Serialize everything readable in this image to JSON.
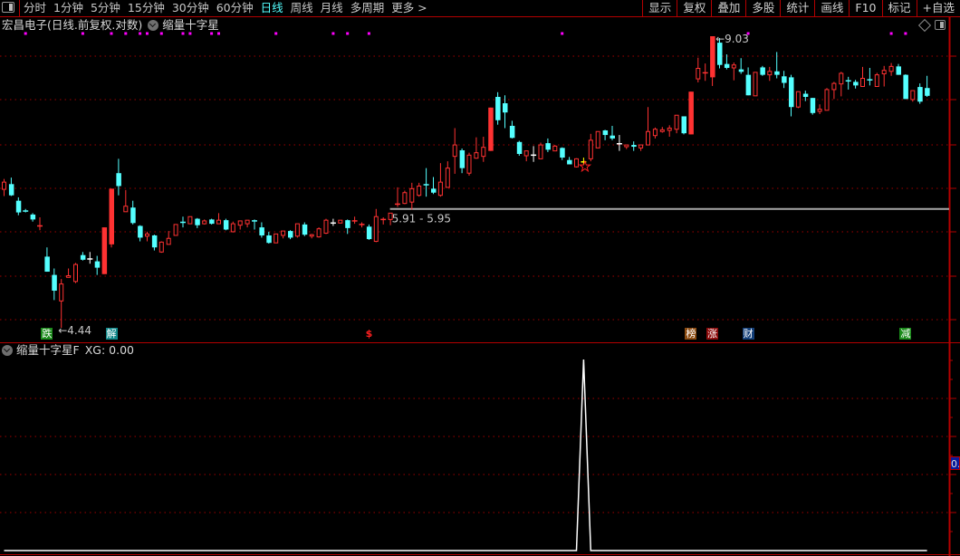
{
  "toolbar": {
    "tabs": [
      "分时",
      "1分钟",
      "5分钟",
      "15分钟",
      "30分钟",
      "60分钟",
      "日线",
      "周线",
      "月线",
      "多周期",
      "更多 >"
    ],
    "active_tab": "日线",
    "right_buttons": [
      "显示",
      "复权",
      "叠加",
      "多股",
      "统计",
      "画线",
      "F10",
      "标记",
      "+自选"
    ]
  },
  "main_panel": {
    "title": "宏昌电子(日线.前复权.对数)",
    "indicator": "缩量十字星",
    "high_label": "9.03",
    "low_label": "4.44",
    "range_label": "5.91 - 5.95",
    "badges": [
      {
        "text": "跌",
        "color": "#1a8a1a",
        "index": 6
      },
      {
        "text": "解",
        "color": "#11888a",
        "index": 15
      },
      {
        "text": "$",
        "color": "#ff2020",
        "index": 51,
        "plain": true
      },
      {
        "text": "榜",
        "color": "#8a4a10",
        "index": 96
      },
      {
        "text": "涨",
        "color": "#8a0a0a",
        "index": 99
      },
      {
        "text": "财",
        "color": "#123e78",
        "index": 104
      },
      {
        "text": "减",
        "color": "#1a8a1a",
        "index": 126
      }
    ]
  },
  "sub_panel": {
    "title": "缩量十字星F",
    "readout": "XG: 0.00",
    "axis_value": "0."
  },
  "colors": {
    "up": "#ff3232",
    "down": "#54ffff",
    "doji": "#ffffff",
    "signal": "#ffff00",
    "grid": "#a00000",
    "axis": "#b40000",
    "marker": "#ff00ff"
  },
  "chart_data": {
    "type": "candlestick",
    "scale": "log",
    "grid": true,
    "candle_format": [
      "open",
      "high",
      "low",
      "close"
    ],
    "candles": [
      [
        6.22,
        6.38,
        6.12,
        6.33
      ],
      [
        6.3,
        6.4,
        6.12,
        6.13
      ],
      [
        6.05,
        6.1,
        5.84,
        5.88
      ],
      [
        5.9,
        5.93,
        5.88,
        5.88
      ],
      [
        5.85,
        5.87,
        5.75,
        5.78
      ],
      [
        5.68,
        5.81,
        5.63,
        5.69
      ],
      [
        5.28,
        5.4,
        5.09,
        5.09
      ],
      [
        5.05,
        5.13,
        4.75,
        4.86
      ],
      [
        4.74,
        5.0,
        4.44,
        4.94
      ],
      [
        5.02,
        5.13,
        5.02,
        5.04
      ],
      [
        4.97,
        5.2,
        4.95,
        5.18
      ],
      [
        5.3,
        5.34,
        5.23,
        5.24
      ],
      [
        5.25,
        5.34,
        5.19,
        5.25
      ],
      [
        5.22,
        5.29,
        5.05,
        5.14
      ],
      [
        5.06,
        5.67,
        5.06,
        5.67
      ],
      [
        5.44,
        6.23,
        5.4,
        6.23
      ],
      [
        6.47,
        6.7,
        6.13,
        6.27
      ],
      [
        5.89,
        6.21,
        5.89,
        5.97
      ],
      [
        5.95,
        6.05,
        5.71,
        5.73
      ],
      [
        5.69,
        5.7,
        5.48,
        5.53
      ],
      [
        5.55,
        5.61,
        5.48,
        5.58
      ],
      [
        5.56,
        5.57,
        5.36,
        5.4
      ],
      [
        5.34,
        5.48,
        5.33,
        5.47
      ],
      [
        5.44,
        5.62,
        5.44,
        5.52
      ],
      [
        5.56,
        5.71,
        5.56,
        5.71
      ],
      [
        5.74,
        5.82,
        5.67,
        5.72
      ],
      [
        5.72,
        5.82,
        5.72,
        5.82
      ],
      [
        5.79,
        5.8,
        5.66,
        5.7
      ],
      [
        5.72,
        5.78,
        5.71,
        5.76
      ],
      [
        5.78,
        5.79,
        5.71,
        5.72
      ],
      [
        5.72,
        5.87,
        5.72,
        5.77
      ],
      [
        5.77,
        5.79,
        5.63,
        5.64
      ],
      [
        5.61,
        5.75,
        5.6,
        5.72
      ],
      [
        5.7,
        5.76,
        5.64,
        5.76
      ],
      [
        5.72,
        5.77,
        5.67,
        5.77
      ],
      [
        5.76,
        5.78,
        5.64,
        5.74
      ],
      [
        5.67,
        5.74,
        5.53,
        5.56
      ],
      [
        5.56,
        5.61,
        5.45,
        5.46
      ],
      [
        5.46,
        5.58,
        5.46,
        5.58
      ],
      [
        5.56,
        5.62,
        5.52,
        5.62
      ],
      [
        5.62,
        5.63,
        5.51,
        5.53
      ],
      [
        5.55,
        5.72,
        5.53,
        5.72
      ],
      [
        5.71,
        5.74,
        5.55,
        5.57
      ],
      [
        5.55,
        5.58,
        5.52,
        5.57
      ],
      [
        5.54,
        5.67,
        5.53,
        5.65
      ],
      [
        5.59,
        5.79,
        5.58,
        5.77
      ],
      [
        5.73,
        5.79,
        5.69,
        5.73
      ],
      [
        5.73,
        5.77,
        5.73,
        5.77
      ],
      [
        5.77,
        5.78,
        5.58,
        5.66
      ],
      [
        5.74,
        5.82,
        5.72,
        5.76
      ],
      [
        5.7,
        5.74,
        5.67,
        5.71
      ],
      [
        5.68,
        5.71,
        5.5,
        5.51
      ],
      [
        5.48,
        5.93,
        5.47,
        5.82
      ],
      [
        5.77,
        5.81,
        5.71,
        5.78
      ],
      [
        5.78,
        5.87,
        5.7,
        5.87
      ],
      [
        5.98,
        6.25,
        5.96,
        6.0
      ],
      [
        6.01,
        6.2,
        6.0,
        6.17
      ],
      [
        6.03,
        6.32,
        5.92,
        6.23
      ],
      [
        6.13,
        6.32,
        6.11,
        6.27
      ],
      [
        6.29,
        6.55,
        6.11,
        6.28
      ],
      [
        6.23,
        6.41,
        6.15,
        6.17
      ],
      [
        6.13,
        6.63,
        6.11,
        6.33
      ],
      [
        6.25,
        6.66,
        6.25,
        6.55
      ],
      [
        6.74,
        7.22,
        6.46,
        6.93
      ],
      [
        6.84,
        6.87,
        6.47,
        6.55
      ],
      [
        6.47,
        6.8,
        6.43,
        6.76
      ],
      [
        6.71,
        7.06,
        6.7,
        6.8
      ],
      [
        6.74,
        7.07,
        6.65,
        6.89
      ],
      [
        6.83,
        7.59,
        6.83,
        7.59
      ],
      [
        7.79,
        7.88,
        7.28,
        7.36
      ],
      [
        7.67,
        7.82,
        7.22,
        7.5
      ],
      [
        7.26,
        7.35,
        7.04,
        7.05
      ],
      [
        6.98,
        7.0,
        6.75,
        6.78
      ],
      [
        6.75,
        6.83,
        6.66,
        6.83
      ],
      [
        6.76,
        6.91,
        6.65,
        6.76
      ],
      [
        6.7,
        6.97,
        6.7,
        6.93
      ],
      [
        6.96,
        7.04,
        6.81,
        6.85
      ],
      [
        6.83,
        6.93,
        6.83,
        6.91
      ],
      [
        6.88,
        6.89,
        6.68,
        6.72
      ],
      [
        6.68,
        6.73,
        6.61,
        6.61
      ],
      [
        6.57,
        6.71,
        6.56,
        6.7
      ],
      [
        6.65,
        6.72,
        6.6,
        6.65
      ],
      [
        6.7,
        7.12,
        6.66,
        7.01
      ],
      [
        6.88,
        7.16,
        6.88,
        7.16
      ],
      [
        7.18,
        7.19,
        7.01,
        7.1
      ],
      [
        7.09,
        7.26,
        7.01,
        7.04
      ],
      [
        6.95,
        7.1,
        6.83,
        6.95
      ],
      [
        6.9,
        6.93,
        6.86,
        6.93
      ],
      [
        6.93,
        6.99,
        6.83,
        6.9
      ],
      [
        6.88,
        6.93,
        6.83,
        6.93
      ],
      [
        6.93,
        7.6,
        6.93,
        7.16
      ],
      [
        7.09,
        7.23,
        7.04,
        7.2
      ],
      [
        7.16,
        7.24,
        7.14,
        7.19
      ],
      [
        7.18,
        7.27,
        7.07,
        7.22
      ],
      [
        7.2,
        7.45,
        7.13,
        7.45
      ],
      [
        7.43,
        7.43,
        7.11,
        7.13
      ],
      [
        7.11,
        7.89,
        7.11,
        7.89
      ],
      [
        8.14,
        8.57,
        8.07,
        8.35
      ],
      [
        8.24,
        8.45,
        8.1,
        8.26
      ],
      [
        8.17,
        9.03,
        8.0,
        9.03
      ],
      [
        8.89,
        8.99,
        8.35,
        8.42
      ],
      [
        8.44,
        8.64,
        8.33,
        8.36
      ],
      [
        8.36,
        8.47,
        8.11,
        8.42
      ],
      [
        8.33,
        8.56,
        8.24,
        8.28
      ],
      [
        8.22,
        8.37,
        7.82,
        7.82
      ],
      [
        7.81,
        8.27,
        7.81,
        8.27
      ],
      [
        8.37,
        8.4,
        8.2,
        8.22
      ],
      [
        8.22,
        8.38,
        8.1,
        8.29
      ],
      [
        8.29,
        8.69,
        8.15,
        8.22
      ],
      [
        8.19,
        8.3,
        7.96,
        8.06
      ],
      [
        8.17,
        8.22,
        7.43,
        7.6
      ],
      [
        7.6,
        7.89,
        7.58,
        7.89
      ],
      [
        7.85,
        7.91,
        7.71,
        7.79
      ],
      [
        7.77,
        7.77,
        7.46,
        7.49
      ],
      [
        7.52,
        7.65,
        7.47,
        7.56
      ],
      [
        7.54,
        7.96,
        7.54,
        7.93
      ],
      [
        7.93,
        8.08,
        7.75,
        8.05
      ],
      [
        8.04,
        8.28,
        7.8,
        8.25
      ],
      [
        8.1,
        8.18,
        7.93,
        8.08
      ],
      [
        8.08,
        8.12,
        7.95,
        8.01
      ],
      [
        7.99,
        8.38,
        7.99,
        8.15
      ],
      [
        8.12,
        8.36,
        8.01,
        8.11
      ],
      [
        7.99,
        8.26,
        7.99,
        8.22
      ],
      [
        8.24,
        8.4,
        7.99,
        8.31
      ],
      [
        8.29,
        8.46,
        8.2,
        8.39
      ],
      [
        8.39,
        8.44,
        8.22,
        8.22
      ],
      [
        8.22,
        8.23,
        7.75,
        7.75
      ],
      [
        7.74,
        7.91,
        7.7,
        7.91
      ],
      [
        7.98,
        8.05,
        7.66,
        7.7
      ],
      [
        7.96,
        8.2,
        7.79,
        7.81
      ]
    ],
    "limit_up_candles": [
      14,
      15,
      68,
      96,
      99
    ],
    "signal_candle": 81,
    "top_markers": [
      3,
      11,
      15,
      17,
      19,
      20,
      22,
      25,
      26,
      29,
      30,
      38,
      46,
      48,
      51,
      78,
      104,
      124,
      126
    ],
    "support_line": {
      "price": 5.93,
      "from_index": 54
    },
    "xg_series": {
      "name": "XG",
      "nonzero": {
        "81": 1
      },
      "ylim": [
        0,
        1
      ]
    }
  }
}
